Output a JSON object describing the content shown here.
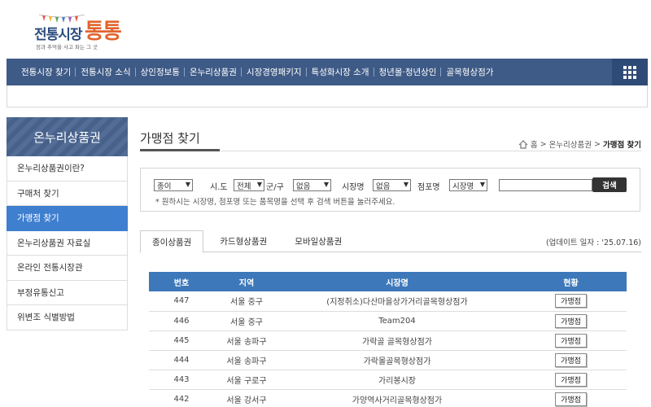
{
  "logo": {
    "main": "전통시장",
    "accent": "통통",
    "sub": "정과 추억을 사고 파는 그 곳"
  },
  "topnav": {
    "items": [
      "전통시장 찾기",
      "전통시장 소식",
      "상인정보통",
      "온누리상품권",
      "시장경영패키지",
      "특성화시장 소개",
      "청년몰·청년상인",
      "골목형상점가"
    ],
    "menu_icon": "grid-menu-icon"
  },
  "sidebar": {
    "title": "온누리상품권",
    "items": [
      "온누리상품권이란?",
      "구매처 찾기",
      "가맹점 찾기",
      "온누리상품권 자료실",
      "온라인 전통시장관",
      "부정유통신고",
      "위변조 식별방법"
    ],
    "active_index": 2
  },
  "page": {
    "title": "가맹점 찾기",
    "breadcrumb": {
      "home": "홈",
      "sep1": ">",
      "parent": "온누리상품권",
      "sep2": ">",
      "current": "가맹점 찾기"
    }
  },
  "search": {
    "type_value": "종이",
    "sido_label": "시.도",
    "sido_value": "전체",
    "gungu_label": "군/구",
    "gungu_value": "없음",
    "market_label": "시장명",
    "market_value": "없음",
    "store_label": "점포명",
    "store_value": "시장명",
    "button": "검색",
    "hint": "* 원하시는 시장명, 점포명 또는 품목명을 선택 후 검색 버튼을 눌러주세요."
  },
  "tabs": [
    "종이상품권",
    "카드형상품권",
    "모바일상품권"
  ],
  "update_text": "(업데이트 일자 : '25.07.16)",
  "table": {
    "headers": [
      "번호",
      "지역",
      "시장명",
      "현황"
    ],
    "rows": [
      {
        "no": "447",
        "region": "서울 중구",
        "market": "(지정취소)다산마을상가거리골목형상점가",
        "status": "가맹점"
      },
      {
        "no": "446",
        "region": "서울 중구",
        "market": "Team204",
        "status": "가맹점"
      },
      {
        "no": "445",
        "region": "서울 송파구",
        "market": "가락골 골목형상점가",
        "status": "가맹점"
      },
      {
        "no": "444",
        "region": "서울 송파구",
        "market": "가락몰골목형상점가",
        "status": "가맹점"
      },
      {
        "no": "443",
        "region": "서울 구로구",
        "market": "가리봉시장",
        "status": "가맹점"
      },
      {
        "no": "442",
        "region": "서울 강서구",
        "market": "가양역사거리골목형상점가",
        "status": "가맹점"
      }
    ]
  },
  "colors": {
    "nav": "#3e5a86",
    "active": "#3f7fd0",
    "table_head": "#3d78ba",
    "accent": "#e1642e"
  }
}
